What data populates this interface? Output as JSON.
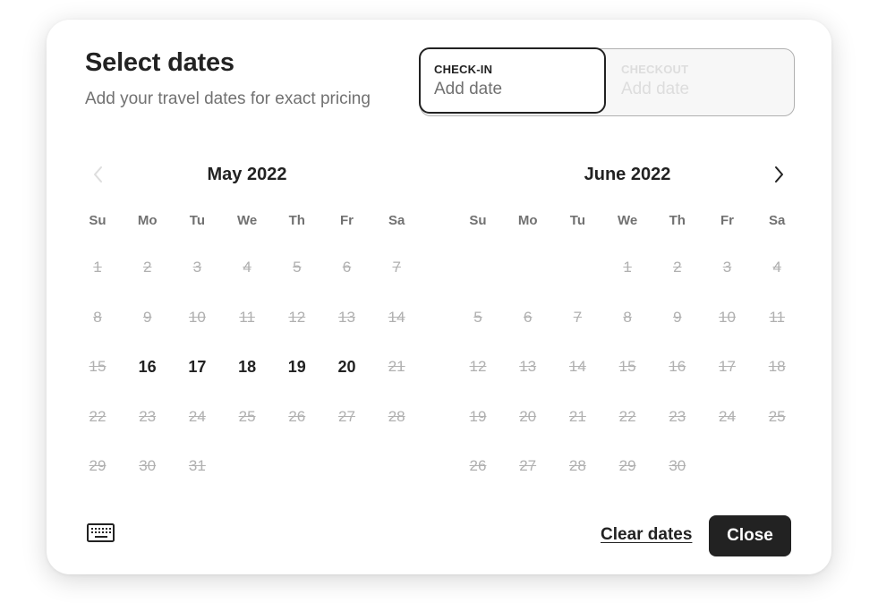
{
  "header": {
    "title": "Select dates",
    "subtitle": "Add your travel dates for exact pricing"
  },
  "date_inputs": {
    "checkin": {
      "label": "CHECK-IN",
      "value": "Add date"
    },
    "checkout": {
      "label": "CHECKOUT",
      "value": "Add date"
    }
  },
  "navigation": {
    "prev_icon": "chevron-left-icon",
    "next_icon": "chevron-right-icon"
  },
  "weekdays": [
    "Su",
    "Mo",
    "Tu",
    "We",
    "Th",
    "Fr",
    "Sa"
  ],
  "months": [
    {
      "title": "May 2022",
      "first_weekday": 0,
      "days_in_month": 31,
      "available_days": [
        16,
        17,
        18,
        19,
        20
      ]
    },
    {
      "title": "June 2022",
      "first_weekday": 3,
      "days_in_month": 30,
      "available_days": []
    }
  ],
  "footer": {
    "keyboard_icon": "keyboard-icon",
    "clear_label": "Clear dates",
    "close_label": "Close"
  },
  "colors": {
    "text_primary": "#222222",
    "text_secondary": "#717171",
    "disabled": "#b0b0b0",
    "button_bg": "#222222"
  }
}
